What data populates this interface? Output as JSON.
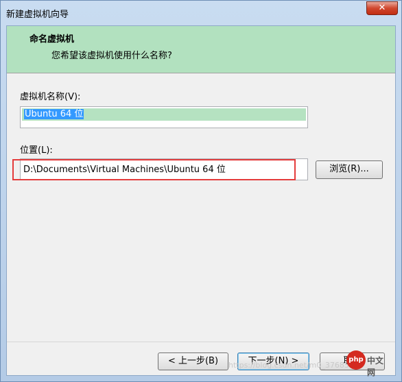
{
  "window": {
    "title": "新建虚拟机向导",
    "close_symbol": "✕"
  },
  "header": {
    "title": "命名虚拟机",
    "subtitle": "您希望该虚拟机使用什么名称?"
  },
  "name_field": {
    "label": "虚拟机名称(V):",
    "value": "Ubuntu 64 位"
  },
  "location_field": {
    "label": "位置(L):",
    "value": "D:\\Documents\\Virtual Machines\\Ubuntu 64 位"
  },
  "buttons": {
    "browse": "浏览(R)...",
    "back": "< 上一步(B)",
    "next": "下一步(N) >",
    "cancel": "取消"
  },
  "watermark": "https://blog.csdn.net/m0_37685419",
  "logo": {
    "php": "php",
    "cn": "中文网"
  }
}
